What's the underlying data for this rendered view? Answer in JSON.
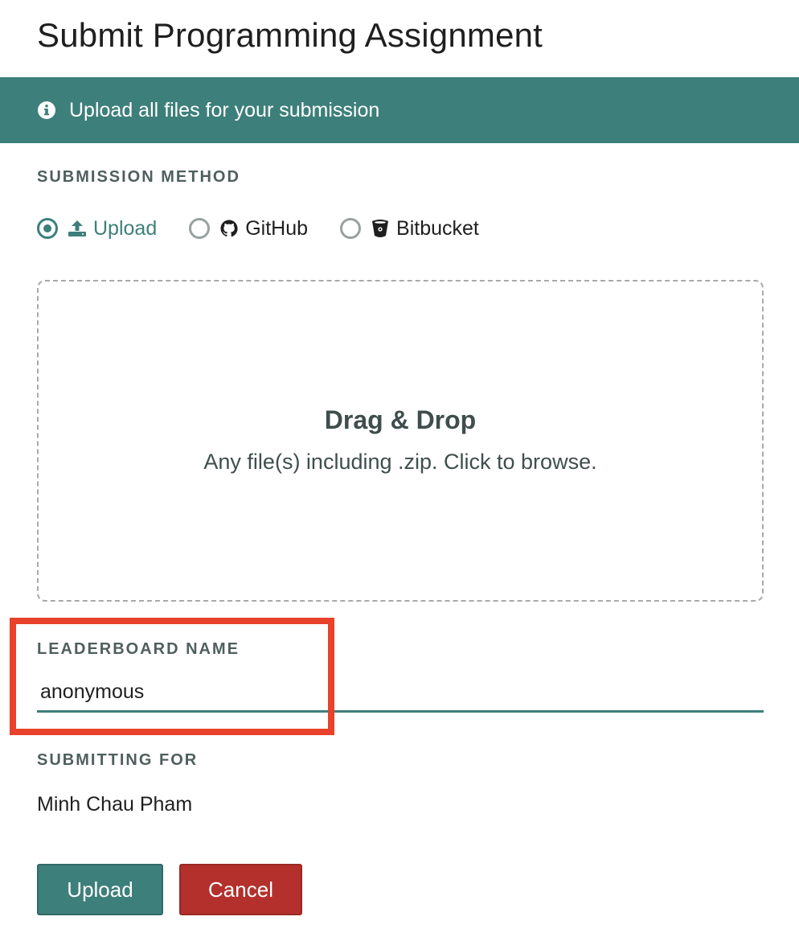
{
  "page": {
    "title": "Submit Programming Assignment"
  },
  "banner": {
    "icon": "info-icon",
    "text": "Upload all files for your submission",
    "color": "#3d7f7a"
  },
  "submission_method": {
    "label": "SUBMISSION METHOD",
    "options": [
      {
        "label": "Upload",
        "icon": "upload-icon",
        "selected": true
      },
      {
        "label": "GitHub",
        "icon": "github-icon",
        "selected": false
      },
      {
        "label": "Bitbucket",
        "icon": "bitbucket-icon",
        "selected": false
      }
    ]
  },
  "dropzone": {
    "title": "Drag & Drop",
    "subtitle": "Any file(s) including .zip. Click to browse."
  },
  "leaderboard": {
    "label": "LEADERBOARD NAME",
    "value": "anonymous"
  },
  "submitting_for": {
    "label": "SUBMITTING FOR",
    "name": "Minh Chau Pham"
  },
  "actions": {
    "upload_label": "Upload",
    "cancel_label": "Cancel",
    "upload_color": "#3d7f7a",
    "cancel_color": "#b3302c"
  },
  "highlight_color": "#e8412c"
}
